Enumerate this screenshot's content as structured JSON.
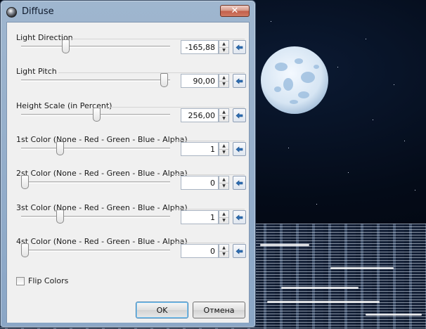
{
  "window": {
    "title": "Diffuse",
    "close_glyph": "✕"
  },
  "controls": [
    {
      "label": "Light Direction",
      "value": "-165,88",
      "slider_fraction": 0.29
    },
    {
      "label": "Light Pitch",
      "value": "90,00",
      "slider_fraction": 0.99
    },
    {
      "label": "Height Scale (in Percent)",
      "value": "256,00",
      "slider_fraction": 0.51
    },
    {
      "label": "1st Color (None - Red - Green - Blue - Alpha)",
      "value": "1",
      "slider_fraction": 0.25
    },
    {
      "label": "2st Color (None - Red - Green - Blue - Alpha)",
      "value": "0",
      "slider_fraction": 0.0
    },
    {
      "label": "3st Color (None - Red - Green - Blue - Alpha)",
      "value": "1",
      "slider_fraction": 0.25
    },
    {
      "label": "4st Color (None - Red - Green - Blue - Alpha)",
      "value": "0",
      "slider_fraction": 0.0
    }
  ],
  "flip_colors": {
    "label": "Flip Colors",
    "checked": false
  },
  "buttons": {
    "ok": "OK",
    "cancel": "Отмена"
  },
  "icons": {
    "reset": "arrow-left-icon",
    "spin_up": "chevron-up-icon",
    "spin_down": "chevron-down-icon"
  },
  "colors": {
    "sky": "#050d1c",
    "moon": "#dbe8f5",
    "accent": "#3c7fb1"
  }
}
